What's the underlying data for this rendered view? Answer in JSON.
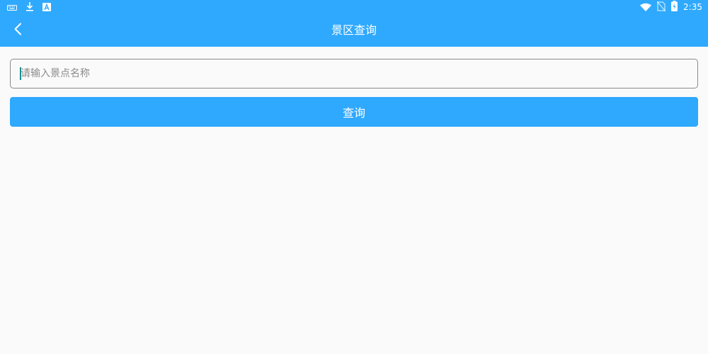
{
  "status_bar": {
    "time": "2:35",
    "left_icons": [
      "keyboard-icon",
      "download-icon",
      "app-notification-icon"
    ],
    "right_icons": [
      "wifi-icon",
      "no-sim-icon",
      "battery-charging-icon"
    ]
  },
  "app_bar": {
    "title": "景区查询",
    "back_icon": "chevron-left-icon"
  },
  "search": {
    "placeholder": "请输入景点名称",
    "value": ""
  },
  "query_button": {
    "label": "查询"
  },
  "colors": {
    "primary": "#2fa9fe",
    "background": "#fafafa",
    "text_on_primary": "#ffffff",
    "placeholder": "#8c8c8c",
    "caret": "#1a8c8c"
  }
}
